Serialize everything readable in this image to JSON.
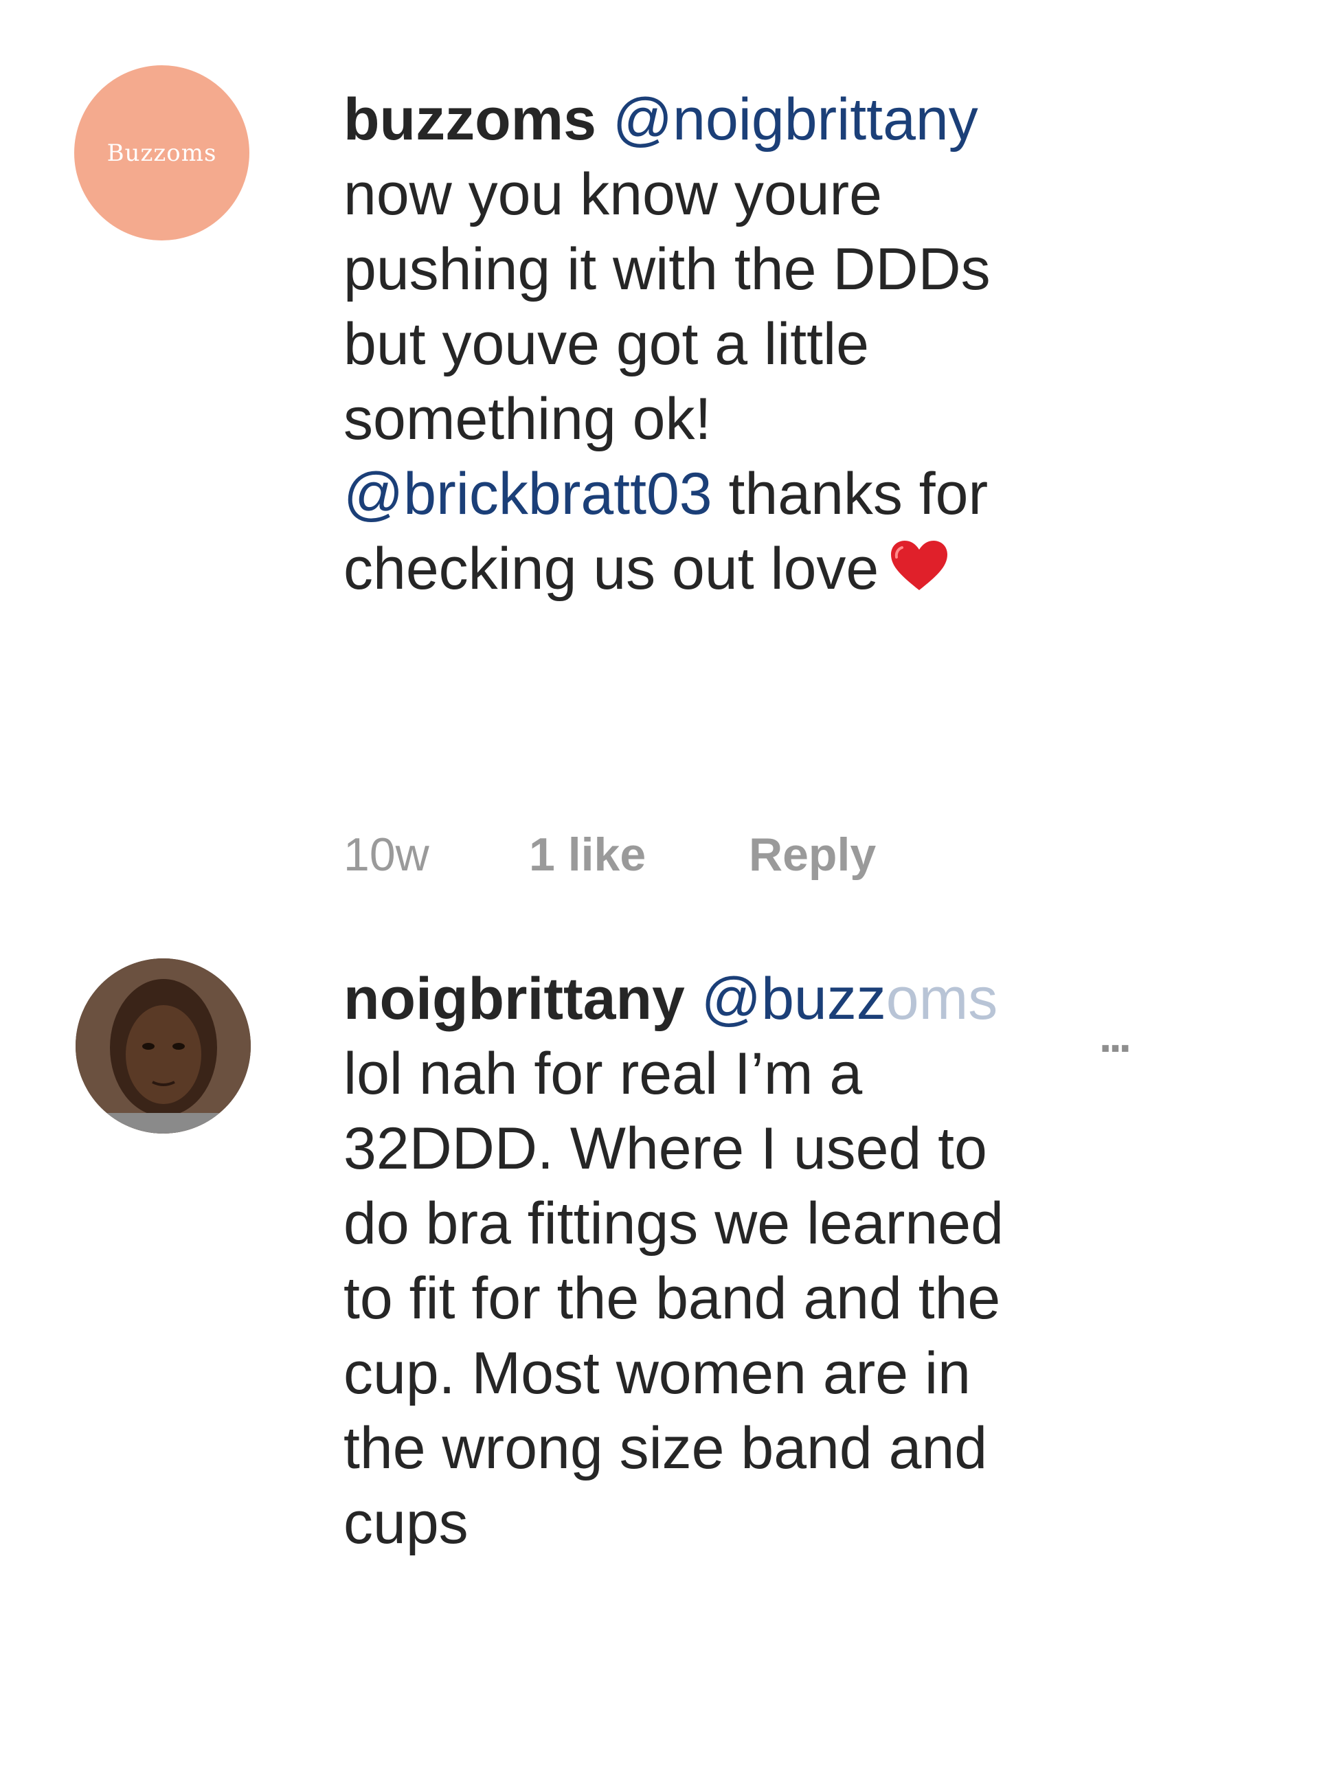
{
  "comments": [
    {
      "username": "buzzoms",
      "avatar_text": "Buzzoms",
      "lines": [
        {
          "mention": "@noigbrittany",
          "text": ""
        },
        {
          "text": "now you know youre"
        },
        {
          "text": "pushing it with the DDDs"
        },
        {
          "text": "but youve got a little"
        },
        {
          "text": "something ok!"
        },
        {
          "mention": "@brickbratt03",
          "text": " thanks for"
        },
        {
          "text": "checking us out love"
        }
      ],
      "emoji": "heart-emoji",
      "time": "10w",
      "likes": "1 like",
      "reply": "Reply"
    },
    {
      "username": "noigbrittany",
      "mention_partial": "@buzz",
      "mention_faded": "oms",
      "more": "...",
      "lines": [
        {
          "text": "lol nah for real I’m a"
        },
        {
          "text": "32DDD. Where I used to"
        },
        {
          "text": "do bra fittings we learned"
        },
        {
          "text": "to fit for the band and the"
        },
        {
          "text": "cup. Most women are in"
        },
        {
          "text": "the wrong size band and"
        },
        {
          "text": "cups"
        }
      ]
    }
  ],
  "colors": {
    "mention": "#1b3f78",
    "meta": "#9a9a9a",
    "avatar1_bg": "#f4aa8e"
  }
}
